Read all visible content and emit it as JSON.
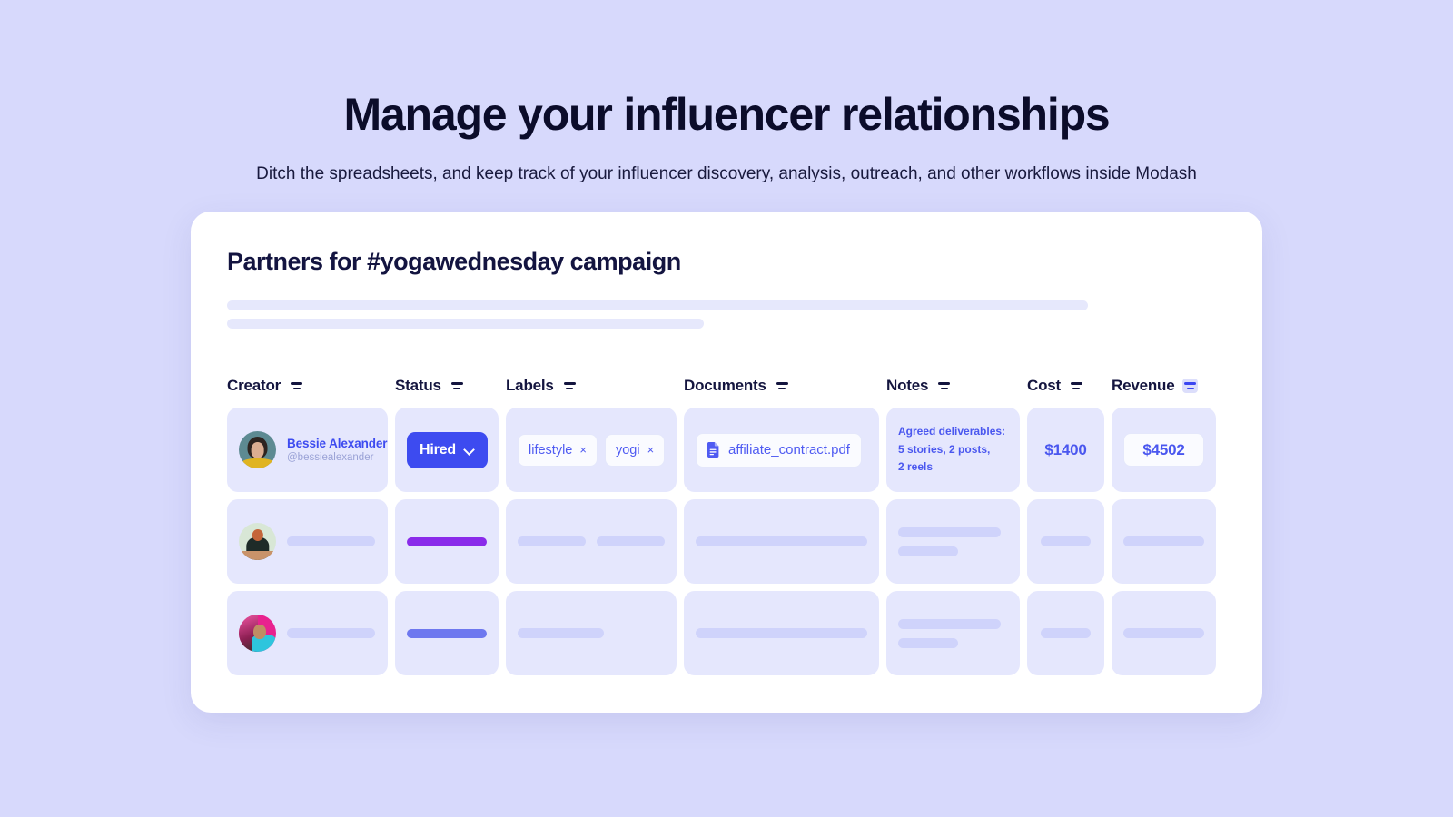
{
  "hero": {
    "title": "Manage your influencer relationships",
    "subtitle": "Ditch the spreadsheets, and keep track of your influencer discovery, analysis, outreach, and other workflows inside Modash"
  },
  "card": {
    "title": "Partners for #yogawednesday campaign"
  },
  "columns": [
    {
      "label": "Creator",
      "filter_icon": "filter-icon",
      "filter_active": false
    },
    {
      "label": "Status",
      "filter_icon": "filter-icon",
      "filter_active": false
    },
    {
      "label": "Labels",
      "filter_icon": "filter-icon",
      "filter_active": false
    },
    {
      "label": "Documents",
      "filter_icon": "filter-icon",
      "filter_active": false
    },
    {
      "label": "Notes",
      "filter_icon": "filter-icon",
      "filter_active": false
    },
    {
      "label": "Cost",
      "filter_icon": "filter-icon",
      "filter_active": false
    },
    {
      "label": "Revenue",
      "filter_icon": "filter-icon",
      "filter_active": true
    }
  ],
  "rows": [
    {
      "creator": {
        "name": "Bessie Alexander",
        "handle": "@bessiealexander",
        "avatar": "avatar-bessie-alexander"
      },
      "status": {
        "label": "Hired",
        "chevron": "chevron-down-icon"
      },
      "labels": [
        {
          "text": "lifestyle",
          "remove": "×"
        },
        {
          "text": "yogi",
          "remove": "×"
        }
      ],
      "document": {
        "name": "affiliate_contract.pdf",
        "icon": "file-document-icon"
      },
      "notes": "Agreed deliverables:\n5 stories, 2 posts,\n2 reels",
      "cost": "$1400",
      "revenue": "$4502"
    },
    {
      "creator": {
        "avatar": "avatar-placeholder-2"
      },
      "status": {
        "bar_color": "#8a2bea"
      }
    },
    {
      "creator": {
        "avatar": "avatar-placeholder-3"
      },
      "status": {
        "bar_color": "#6e78ef"
      }
    }
  ],
  "colors": {
    "page_background": "#d7d9fc",
    "card_background": "#ffffff",
    "cell_background": "#e5e7fd",
    "accent_blue": "#3d4bf2",
    "accent_purple": "#8a2bea",
    "accent_indigo": "#6e78ef",
    "skeleton": "#cfd3fb",
    "title_navy": "#131440"
  }
}
